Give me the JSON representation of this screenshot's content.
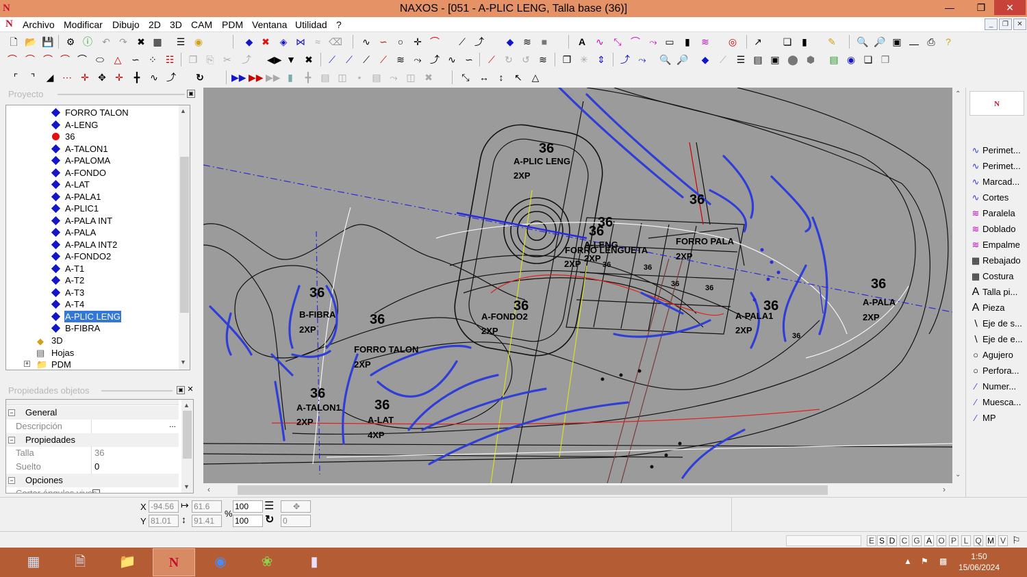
{
  "window": {
    "title": "NAXOS - [051 - A-PLIC LENG, Talla base (36)]",
    "logo": "N"
  },
  "menu": [
    "Archivo",
    "Modificar",
    "Dibujo",
    "2D",
    "3D",
    "CAM",
    "PDM",
    "Ventana",
    "Utilidad",
    "?"
  ],
  "panels": {
    "project_title": "Proyecto",
    "props_title": "Propiedades objetos"
  },
  "tree": {
    "items": [
      {
        "label": "FORRO TALON",
        "type": "diamond"
      },
      {
        "label": "A-LENG",
        "type": "diamond"
      },
      {
        "label": "36",
        "type": "red-circle"
      },
      {
        "label": "A-TALON1",
        "type": "diamond"
      },
      {
        "label": "A-PALOMA",
        "type": "diamond"
      },
      {
        "label": "A-FONDO",
        "type": "diamond"
      },
      {
        "label": "A-LAT",
        "type": "diamond"
      },
      {
        "label": "A-PALA1",
        "type": "diamond"
      },
      {
        "label": "A-PLIC1",
        "type": "diamond"
      },
      {
        "label": "A-PALA INT",
        "type": "diamond"
      },
      {
        "label": "A-PALA",
        "type": "diamond"
      },
      {
        "label": "A-PALA INT2",
        "type": "diamond"
      },
      {
        "label": "A-FONDO2",
        "type": "diamond"
      },
      {
        "label": "A-T1",
        "type": "diamond"
      },
      {
        "label": "A-T2",
        "type": "diamond"
      },
      {
        "label": "A-T3",
        "type": "diamond"
      },
      {
        "label": "A-T4",
        "type": "diamond"
      },
      {
        "label": "A-PLIC LENG",
        "type": "diamond",
        "selected": true
      },
      {
        "label": "B-FIBRA",
        "type": "diamond"
      }
    ],
    "folders": [
      "3D",
      "Hojas",
      "PDM"
    ]
  },
  "properties": {
    "general_label": "General",
    "descripcion_label": "Descripción",
    "descripcion_value": "...",
    "propiedades_label": "Propiedades",
    "talla_label": "Talla",
    "talla_value": "36",
    "suelto_label": "Suelto",
    "suelto_value": "0",
    "opciones_label": "Opciones",
    "cortar_label": "Cortar ángulos vivos"
  },
  "canvas_labels": {
    "plic_size": "36",
    "plic_name": "A-PLIC LENG",
    "plic_qty": "2XP",
    "fibra_size": "36",
    "fibra_name": "B-FIBRA",
    "fibra_qty": "2XP",
    "talon_size": "36",
    "talon_name": "A-TALON1",
    "talon_qty": "2XP",
    "lat_size": "36",
    "lat_name": "A-LAT",
    "lat_qty": "4XP",
    "forro_talon_size": "36",
    "forro_talon_name": "FORRO TALON",
    "forro_talon_qty": "2XP",
    "fondo2_size": "36",
    "fondo2_name": "A-FONDO2",
    "fondo2_qty": "2XP",
    "leng_size": "36",
    "leng_size2": "36",
    "leng_name": "A-LENG",
    "leng_qty": "2XP",
    "forro_leng_name": "FORRO LENGUETA",
    "forro_leng_qty": "2XP",
    "forro_pala_name": "FORRO PALA",
    "forro_pala_qty": "2XP",
    "pala1_size": "36",
    "pala1_name": "A-PALA1",
    "pala1_qty": "2XP",
    "pala_size": "36",
    "pala_name": "A-PALA",
    "pala_qty": "2XP",
    "top36": "36",
    "small36a": "36",
    "small36b": "36",
    "small36c": "36",
    "small36d": "36",
    "small36e": "36"
  },
  "tools": [
    {
      "label": "Perimet...",
      "icon": "curve-icon"
    },
    {
      "label": "Perimet...",
      "icon": "curve-icon"
    },
    {
      "label": "Marcad...",
      "icon": "curve-icon"
    },
    {
      "label": "Cortes",
      "icon": "curve-icon"
    },
    {
      "label": "Paralela",
      "icon": "parallel-icon"
    },
    {
      "label": "Doblado",
      "icon": "parallel-icon"
    },
    {
      "label": "Empalme",
      "icon": "parallel-icon"
    },
    {
      "label": "Rebajado",
      "icon": "rebajado-icon"
    },
    {
      "label": "Costura",
      "icon": "rebajado-icon"
    },
    {
      "label": "Talla pi...",
      "icon": "text-icon"
    },
    {
      "label": "Pieza",
      "icon": "text-icon"
    },
    {
      "label": "Eje de s...",
      "icon": "axis-icon"
    },
    {
      "label": "Eje de e...",
      "icon": "axis-icon"
    },
    {
      "label": "Agujero",
      "icon": "circle-icon"
    },
    {
      "label": "Perfora...",
      "icon": "circle-icon"
    },
    {
      "label": "Numer...",
      "icon": "pen-icon"
    },
    {
      "label": "Muesca...",
      "icon": "pen-icon"
    },
    {
      "label": "MP",
      "icon": "pen-icon"
    }
  ],
  "status": {
    "x_label": "X",
    "y_label": "Y",
    "x_value": "-94.56",
    "y_value": "81.01",
    "w_value": "61.6",
    "h_value": "91.41",
    "scale_x": "100",
    "scale_y": "100",
    "percent": "%",
    "angle": "0",
    "modes": [
      "E",
      "S",
      "D",
      "C",
      "G",
      "A",
      "O",
      "P",
      "L",
      "Q",
      "M",
      "V"
    ]
  },
  "clock": {
    "time": "1:50",
    "date": "15/06/2024"
  },
  "colors": {
    "titlebar": "#e59267",
    "taskbar": "#b45d34",
    "canvas": "#9b9b9b",
    "selection": "#3377d9",
    "diamond": "#1414c8"
  }
}
